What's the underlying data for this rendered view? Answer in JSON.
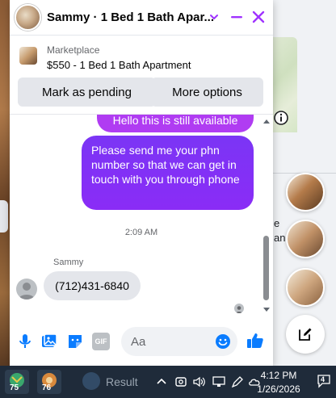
{
  "chat": {
    "title": "Sammy · 1 Bed 1 Bath Apar...",
    "listing": {
      "kicker": "Marketplace",
      "title": "$550 - 1 Bed 1 Bath Apartment"
    },
    "buttons": {
      "pending": "Mark as pending",
      "more": "More options"
    },
    "messages": {
      "out_1": "Hello this is still available",
      "out_2": "Please send me your phn number so that we can get in touch with you through phone",
      "timestamp": "2:09 AM",
      "sender": "Sammy",
      "in_1": "(712)431-6840"
    },
    "composer": {
      "placeholder": "Aa",
      "gif_label": "GIF"
    }
  },
  "background": {
    "sidetext": "e\nan"
  },
  "taskbar": {
    "app1_badge": "75",
    "app2_badge": "76",
    "result_label": "Result",
    "time": "4:12 PM",
    "date": "1/26/2026",
    "notifications": "4"
  },
  "colors": {
    "accent": "#8a2cf6",
    "header_icons": "#a033ff",
    "like": "#0a7cff"
  }
}
